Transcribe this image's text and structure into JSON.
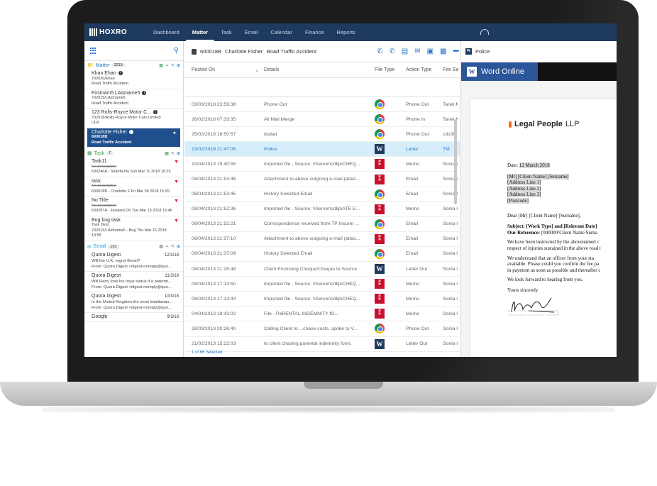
{
  "nav": {
    "brand": "HOXRO",
    "items": [
      "Dashboard",
      "Matter",
      "Task",
      "Email",
      "Calendar",
      "Finance",
      "Reports"
    ]
  },
  "left": {
    "matter": {
      "label": "Matter",
      "count": "3215",
      "items": [
        {
          "title": "Khan Ehan",
          "ref": "702020/Ehan",
          "desc": "Road Traffic Accident"
        },
        {
          "title": "Firstnam5 LAstname5",
          "ref": "702019/LAstname5",
          "desc": "Road Traffic Accident"
        },
        {
          "title": "123 Rolls-Royce Motor C...",
          "ref": "702018/Rolls-Royce Motor Cars Limited",
          "desc": "ULR"
        },
        {
          "title": "Charlotte Fisher",
          "ref": "600018B",
          "desc": "Road Traffic Accident"
        }
      ]
    },
    "task": {
      "label": "Task",
      "count": "7",
      "items": [
        {
          "title": "Task11",
          "desc": "No description",
          "meta": "600246A - Sharifa-Na Sun Mar 11 2018 16:29"
        },
        {
          "title": "task",
          "desc": "No description",
          "meta": "600018B - Charlotte F Fri Mar 09 2018 15:29"
        },
        {
          "title": "No Title",
          "desc": "No description",
          "meta": "600287A - Jaswant Dh Tue Mar 13 2018 16:46"
        },
        {
          "title": "Bug bug task",
          "desc": "Task Desc",
          "meta": "702019/LAstname5 - Bug Thu Mar 15 2018 19:58"
        }
      ]
    },
    "email": {
      "label": "Email",
      "count": "101",
      "items": [
        {
          "title": "Quora Digest",
          "date": "12/3/18",
          "subject": "Will the U.K. regret Brexit?",
          "from": "From: Quora Digest <digest-noreply@quo..."
        },
        {
          "title": "Quora Digest",
          "date": "11/3/18",
          "subject": "Will Harry lose his royal status if a paternit...",
          "from": "From: Quora Digest <digest-noreply@quo..."
        },
        {
          "title": "Quora Digest",
          "date": "10/3/18",
          "subject": "Is the United Kingdom the most totalitarian...",
          "from": "From: Quora Digest <digest-noreply@quo..."
        },
        {
          "title": "Google",
          "date": "9/3/18",
          "subject": "",
          "from": ""
        }
      ]
    }
  },
  "center": {
    "crumb": {
      "ref": "600018B",
      "client": "Charlotte Fisher",
      "matter": "Road Traffic Accident"
    },
    "headers": {
      "posted_on": "Posted On",
      "details": "Details",
      "file_type": "File Type",
      "action_type": "Action Type",
      "fee": "Fee Ea"
    },
    "rows": [
      {
        "date": "03/03/2018 23:59:38",
        "details": "Phone Out",
        "ft": "chrome",
        "action": "Phone Out",
        "fee": "Tarek N"
      },
      {
        "date": "26/02/2018 07:33:35",
        "details": "All Mail Merge",
        "ft": "chrome",
        "action": "Phone In",
        "fee": "Tarek N"
      },
      {
        "date": "25/02/2018 16:50:57",
        "details": "dsdad",
        "ft": "chrome",
        "action": "Phone Out",
        "fee": "cds39"
      },
      {
        "date": "13/02/2018 21:47:06",
        "details": "Police",
        "ft": "word",
        "action": "Letter",
        "fee": "TM"
      },
      {
        "date": "10/04/2013 19:40:55",
        "details": "Imported file - Source: \\\\Server\\cdlip\\CHEQ...",
        "ft": "pdf",
        "action": "Memo",
        "fee": "Sonia I"
      },
      {
        "date": "08/04/2013 21:53:46",
        "details": "Attachment to above outgoing e-mail (attac...",
        "ft": "pdf",
        "action": "Email",
        "fee": "Sonia I"
      },
      {
        "date": "08/04/2013 21:53:45",
        "details": "History Selected Email",
        "ft": "chrome",
        "action": "Email",
        "fee": "Sonia I"
      },
      {
        "date": "08/04/2013 21:52:36",
        "details": "Imported file - Source: \\\\Server\\cdlip\\ATE E...",
        "ft": "pdf",
        "action": "Memo",
        "fee": "Sonia I"
      },
      {
        "date": "08/04/2013 21:52:21",
        "details": "Correspondence received from TP Insurer ...",
        "ft": "chrome",
        "action": "Email",
        "fee": "Sonia I"
      },
      {
        "date": "08/04/2013 21:37:10",
        "details": "Attachment to above outgoing e-mail (attac...",
        "ft": "pdf",
        "action": "Email",
        "fee": "Sonia I"
      },
      {
        "date": "08/04/2013 21:37:09",
        "details": "History Selected Email",
        "ft": "chrome",
        "action": "Email",
        "fee": "Sonia I"
      },
      {
        "date": "08/04/2013 21:26:48",
        "details": "Client Enclosing Cheque/Cheque to Source",
        "ft": "word",
        "action": "Letter Out",
        "fee": "Sonia I"
      },
      {
        "date": "08/04/2013 17:13:50",
        "details": "Imported file - Source: \\\\Server\\cdlip\\CHEQ...",
        "ft": "pdf",
        "action": "Memo",
        "fee": "Sonia I"
      },
      {
        "date": "08/04/2013 17:13:44",
        "details": "Imported file - Source: \\\\Server\\cdlip\\CHEQ...",
        "ft": "pdf",
        "action": "Memo",
        "fee": "Sonia I"
      },
      {
        "date": "04/04/2013 19:43:02",
        "details": "File - PaRENTAL INDEMNITY fO...",
        "ft": "pdf",
        "action": "Memo",
        "fee": "Sonia I"
      },
      {
        "date": "28/03/2013 20:26:40",
        "details": "Calling Client to ...chase costs. spoke to V...",
        "ft": "chrome",
        "action": "Phone Out",
        "fee": "Sonia I"
      },
      {
        "date": "21/02/2013 15:22:03",
        "details": "to client chasing parental indemnity form.",
        "ft": "word",
        "action": "Letter Out",
        "fee": "Sonia I"
      }
    ],
    "footer": "1 of 66 Selected"
  },
  "right": {
    "title": "Police",
    "word_online": "Word Online",
    "doc": {
      "firm": "Legal People",
      "firm_suffix": "LLP",
      "date_label": "Date:",
      "date": "12 March 2018",
      "address": [
        "[Mr] [Client  Name] [Surname]",
        "[Address Line  1]",
        "[Address Line  2]",
        "[Address Line  3]",
        "[Postcode]"
      ],
      "salutation_prefix": "Dear",
      "salutation": "[Mr] [Client  Name]  [Surname],",
      "subject_label": "Subject:",
      "subject": "[Work Type] and [Relevant  Date]",
      "ourref_label": "Our Reference:",
      "ourref": "[000000/Client  Name  Surna",
      "body": [
        "We have been instructed by the abovenamed c",
        "respect of injuries sustained in the above road t",
        "We understand that an officer from your sta",
        "available. Please could you confirm the fee pa",
        "in payment as soon as possible and thereafter c",
        "We look forward to hearing from you.",
        "Yours sincerely"
      ]
    }
  }
}
